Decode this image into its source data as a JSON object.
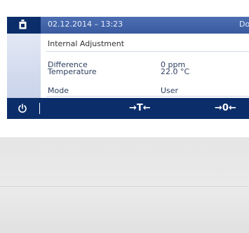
{
  "status_bar": {
    "datetime": "02.12.2014 – 13:23",
    "user": "Do"
  },
  "panel": {
    "title": "Internal Adjustment",
    "rows": [
      {
        "label": "Difference",
        "value": "0 ppm"
      },
      {
        "label": "Temperature",
        "value": "22.0 °C"
      }
    ],
    "mode": {
      "label": "Mode",
      "value": "User"
    }
  },
  "action_bar": {
    "power_icon": "power-icon",
    "tare_label": "→T←",
    "zero_label": "→0←"
  },
  "colors": {
    "top_bar": "#4466aa",
    "action_bar": "#0b2e6a",
    "side_panel": "#c9d3ea"
  }
}
